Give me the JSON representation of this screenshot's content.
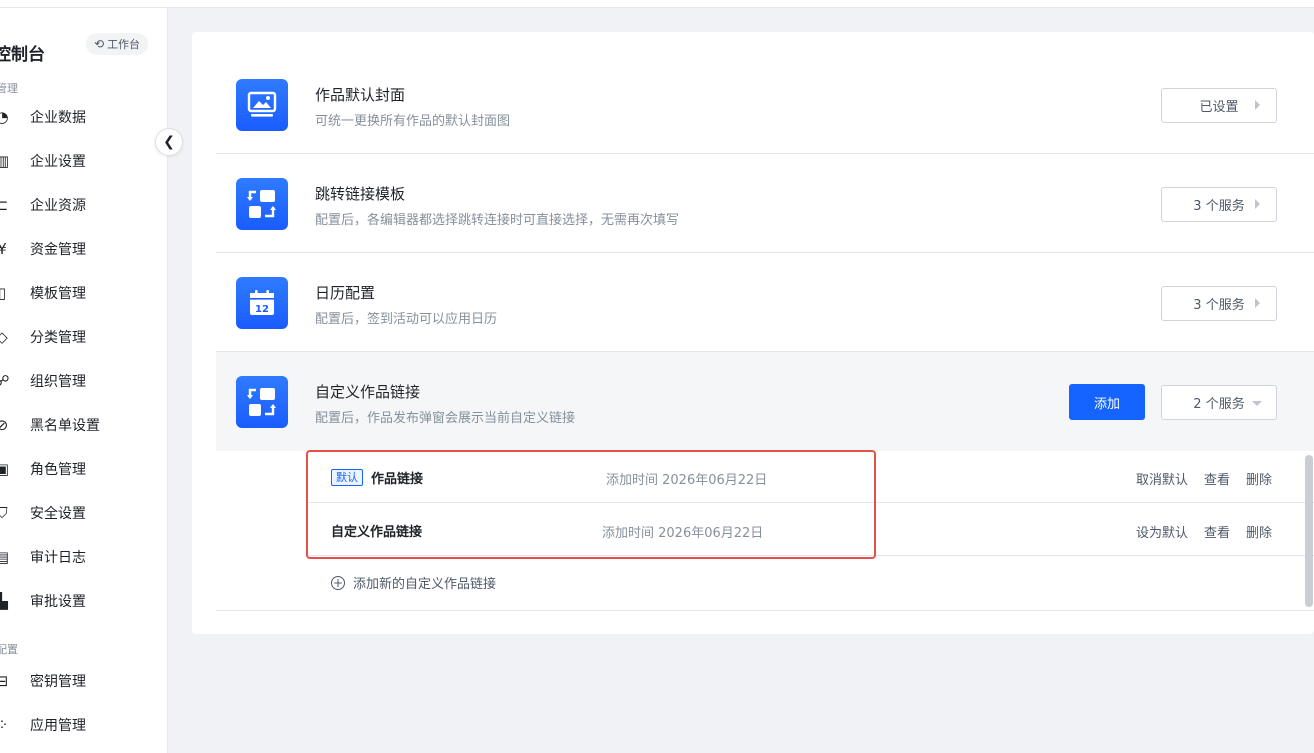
{
  "sidebar": {
    "brand": "控制台",
    "workbench_label": "工作台",
    "group1_label": "管理",
    "group2_label": "配置",
    "items": [
      {
        "label": "企业数据",
        "icon": "◔"
      },
      {
        "label": "企业设置",
        "icon": "▥"
      },
      {
        "label": "企业资源",
        "icon": "⊏"
      },
      {
        "label": "资金管理",
        "icon": "¥"
      },
      {
        "label": "模板管理",
        "icon": "▯"
      },
      {
        "label": "分类管理",
        "icon": "◇"
      },
      {
        "label": "组织管理",
        "icon": "☍"
      },
      {
        "label": "黑名单设置",
        "icon": "⊘"
      },
      {
        "label": "角色管理",
        "icon": "▣"
      },
      {
        "label": "安全设置",
        "icon": "⛉"
      },
      {
        "label": "审计日志",
        "icon": "▤"
      },
      {
        "label": "审批设置",
        "icon": "▙"
      }
    ],
    "items2": [
      {
        "label": "密钥管理",
        "icon": "⊟"
      },
      {
        "label": "应用管理",
        "icon": "⁘"
      }
    ]
  },
  "settings": [
    {
      "title": "作品默认封面",
      "desc": "可统一更换所有作品的默认封面图",
      "button": "已设置",
      "icon": "image-icon"
    },
    {
      "title": "跳转链接模板",
      "desc": "配置后，各编辑器都选择跳转连接时可直接选择，无需再次填写",
      "button": "3 个服务",
      "icon": "link-template-icon"
    },
    {
      "title": "日历配置",
      "desc": "配置后，签到活动可以应用日历",
      "button": "3 个服务",
      "icon": "calendar-icon",
      "calendar_day": "12"
    },
    {
      "title": "自定义作品链接",
      "desc": "配置后，作品发布弹窗会展示当前自定义链接",
      "button": "2 个服务",
      "add_label": "添加",
      "icon": "custom-link-icon"
    }
  ],
  "links": [
    {
      "badge": "默认",
      "name": "作品链接",
      "time": "添加时间 2026年06月22日",
      "actions": [
        "取消默认",
        "查看",
        "删除"
      ]
    },
    {
      "badge": "",
      "name": "自定义作品链接",
      "time": "添加时间 2026年06月22日",
      "actions": [
        "设为默认",
        "查看",
        "删除"
      ]
    }
  ],
  "add_new_label": "添加新的自定义作品链接",
  "colors": {
    "primary": "#1664ff",
    "highlight": "#e5504a"
  }
}
